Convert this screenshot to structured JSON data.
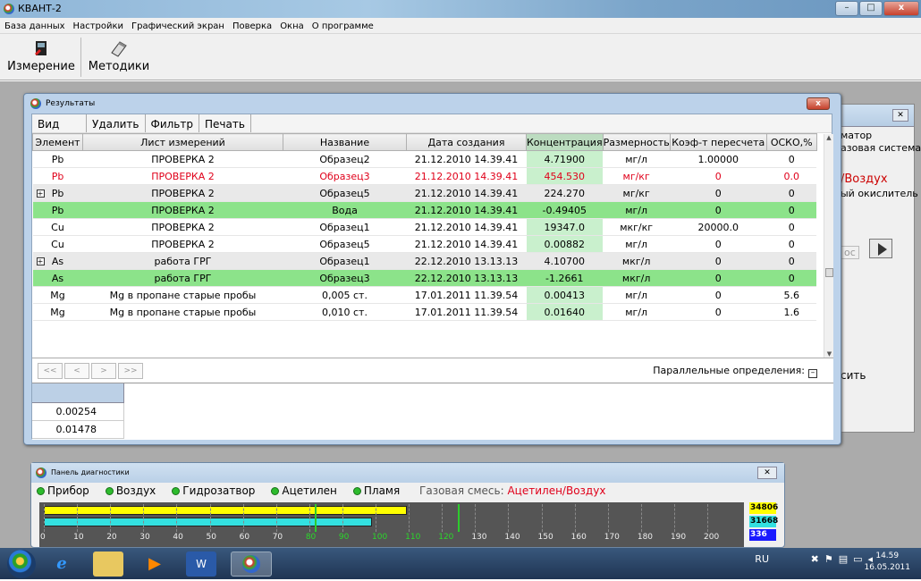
{
  "window": {
    "title": "КВАНТ-2",
    "controls": [
      "–",
      "□",
      "x"
    ]
  },
  "menu": [
    "База данных",
    "Настройки",
    "Графический экран",
    "Поверка",
    "Окна",
    "О программе"
  ],
  "toolbar": {
    "measure": "Измерение",
    "methods": "Методики"
  },
  "background_window": {
    "lines": [
      "матор",
      "азовая система"
    ],
    "big": "/Воздух",
    "line3": "ый окислитель",
    "btn": "ос",
    "bottom": "сить"
  },
  "results": {
    "title": "Результаты",
    "menu": [
      "Вид",
      "Удалить",
      "Фильтр",
      "Печать"
    ],
    "columns": [
      "Элемент",
      "Лист измерений",
      "Название",
      "Дата создания",
      "Концентрация",
      "Размерность",
      "Коэф-т пересчета",
      "ОСКО,%"
    ],
    "rows": [
      {
        "el": "Pb",
        "sheet": "ПРОВЕРКА 2",
        "name": "Образец2",
        "date": "21.12.2010 14.39.41",
        "conc": "4.71900",
        "unit": "мг/л",
        "coef": "1.00000",
        "osko": "0",
        "style": "white",
        "exp": ""
      },
      {
        "el": "Pb",
        "sheet": "ПРОВЕРКА 2",
        "name": "Образец3",
        "date": "21.12.2010 14.39.41",
        "conc": "454.530",
        "unit": "мг/кг",
        "coef": "0",
        "osko": "0.0",
        "style": "red",
        "exp": ""
      },
      {
        "el": "Pb",
        "sheet": "ПРОВЕРКА 2",
        "name": "Образец5",
        "date": "21.12.2010 14.39.41",
        "conc": "224.270",
        "unit": "мг/кг",
        "coef": "0",
        "osko": "0",
        "style": "gray",
        "exp": "+"
      },
      {
        "el": "Pb",
        "sheet": "ПРОВЕРКА 2",
        "name": "Вода",
        "date": "21.12.2010 14.39.41",
        "conc": "-0.49405",
        "unit": "мг/л",
        "coef": "0",
        "osko": "0",
        "style": "green",
        "exp": ""
      },
      {
        "el": "Cu",
        "sheet": "ПРОВЕРКА 2",
        "name": "Образец1",
        "date": "21.12.2010 14.39.41",
        "conc": "19347.0",
        "unit": "мкг/кг",
        "coef": "20000.0",
        "osko": "0",
        "style": "white",
        "exp": ""
      },
      {
        "el": "Cu",
        "sheet": "ПРОВЕРКА 2",
        "name": "Образец5",
        "date": "21.12.2010 14.39.41",
        "conc": "0.00882",
        "unit": "мг/л",
        "coef": "0",
        "osko": "0",
        "style": "white",
        "exp": ""
      },
      {
        "el": "As",
        "sheet": "работа ГРГ",
        "name": "Образец1",
        "date": "22.12.2010 13.13.13",
        "conc": "4.10700",
        "unit": "мкг/л",
        "coef": "0",
        "osko": "0",
        "style": "gray",
        "exp": "+"
      },
      {
        "el": "As",
        "sheet": "работа ГРГ",
        "name": "Образец3",
        "date": "22.12.2010 13.13.13",
        "conc": "-1.2661",
        "unit": "мкг/л",
        "coef": "0",
        "osko": "0",
        "style": "green",
        "exp": ""
      },
      {
        "el": "Mg",
        "sheet": "Mg в пропане старые пробы",
        "name": "0,005 ст.",
        "date": "17.01.2011 11.39.54",
        "conc": "0.00413",
        "unit": "мг/л",
        "coef": "0",
        "osko": "5.6",
        "style": "white",
        "exp": ""
      },
      {
        "el": "Mg",
        "sheet": "Mg в пропане старые пробы",
        "name": "0,010 ст.",
        "date": "17.01.2011 11.39.54",
        "conc": "0.01640",
        "unit": "мг/л",
        "coef": "0",
        "osko": "1.6",
        "style": "white",
        "exp": ""
      }
    ],
    "nav": [
      "<<",
      "<",
      ">",
      ">>"
    ],
    "parallel": "Параллельные определения:",
    "sub_values": [
      "0.00254",
      "0.01478"
    ]
  },
  "diagnostics": {
    "title": "Панель диагностики",
    "items": [
      "Прибор",
      "Воздух",
      "Гидрозатвор",
      "Ацетилен",
      "Пламя"
    ],
    "gas_label": "Газовая смесь:",
    "gas_value": "Ацетилен/Воздух",
    "ticks": [
      "0",
      "10",
      "20",
      "30",
      "40",
      "50",
      "60",
      "70",
      "80",
      "90",
      "100",
      "110",
      "120",
      "130",
      "140",
      "150",
      "160",
      "170",
      "180",
      "190",
      "200"
    ],
    "green_ticks": [
      "80",
      "90",
      "100",
      "110",
      "120"
    ],
    "yellow_level_pct": 52,
    "cyan_level_pct": 47,
    "values": [
      {
        "v": "34806",
        "color": "#ffff00"
      },
      {
        "v": "31668",
        "color": "#33e0e0"
      },
      {
        "v": "336",
        "color": "#1a1aff"
      }
    ]
  },
  "taskbar": {
    "lang": "RU",
    "time": "14.59",
    "date": "16.05.2011"
  }
}
